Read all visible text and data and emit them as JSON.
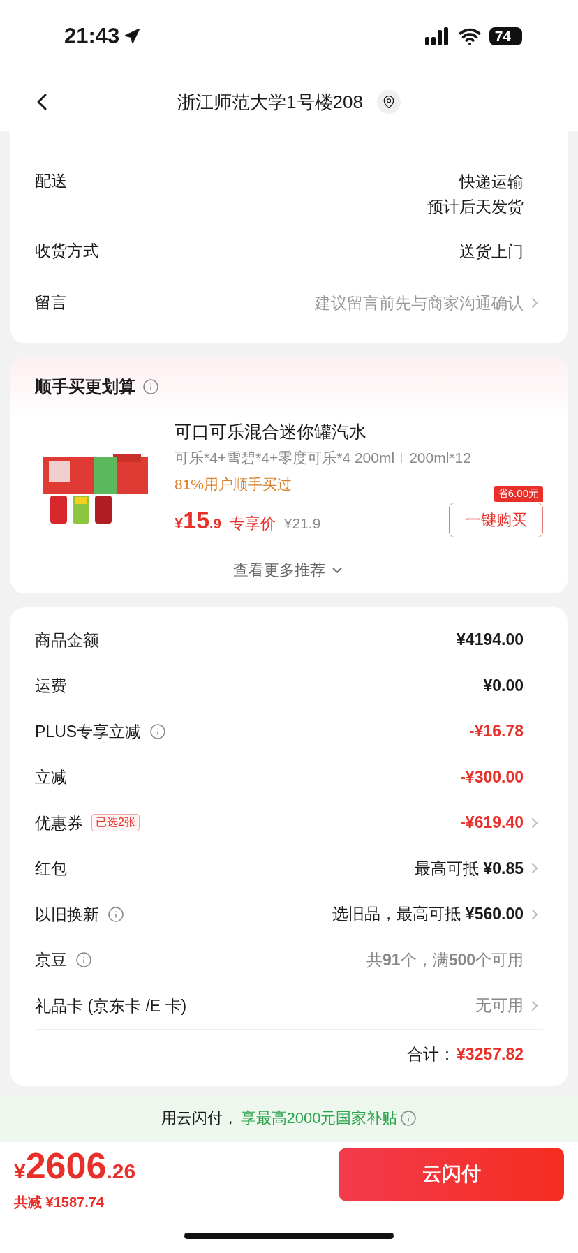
{
  "status_bar": {
    "time": "21:43",
    "battery": "74"
  },
  "header": {
    "title": "浙江师范大学1号楼208"
  },
  "order_info": [
    {
      "label": "配送",
      "values": [
        "快递运输",
        "预计后天发货"
      ],
      "muted": false,
      "chevron": false
    },
    {
      "label": "收货方式",
      "values": [
        "送货上门"
      ],
      "muted": false,
      "chevron": false
    },
    {
      "label": "留言",
      "values": [
        "建议留言前先与商家沟通确认"
      ],
      "muted": true,
      "chevron": true
    }
  ],
  "recommend": {
    "title": "顺手买更划算",
    "product": {
      "name": "可口可乐混合迷你罐汽水",
      "spec": "可乐*4+雪碧*4+零度可乐*4 200ml",
      "spec_size": "200ml*12",
      "social_proof": "81%用户顺手买过",
      "currency": "¥",
      "price_int": "15",
      "price_dec": ".9",
      "price_label": "专享价",
      "original_price": "¥21.9",
      "save_badge": "省6.00元",
      "buy_button": "一键购买"
    },
    "more": "查看更多推荐"
  },
  "summary": [
    {
      "label": "商品金额",
      "info": false,
      "value": "¥4194.00",
      "kind": "amount",
      "chevron": false
    },
    {
      "label": "运费",
      "info": false,
      "value": "¥0.00",
      "kind": "amount",
      "chevron": false
    },
    {
      "label": "PLUS专享立减",
      "info": true,
      "value": "-¥16.78",
      "kind": "discount",
      "chevron": false
    },
    {
      "label": "立减",
      "info": false,
      "value": "-¥300.00",
      "kind": "discount",
      "chevron": false
    },
    {
      "label": "优惠券",
      "info": false,
      "tag": "已选2张",
      "value": "-¥619.40",
      "kind": "discount",
      "chevron": true
    },
    {
      "label": "红包",
      "info": false,
      "value": "最高可抵 **¥0.85**",
      "kind": "text",
      "chevron": true
    },
    {
      "label": "以旧换新",
      "info": true,
      "value": "选旧品，最高可抵 **¥560.00**",
      "kind": "text",
      "chevron": true
    },
    {
      "label": "京豆",
      "info": true,
      "value": "共**91**个，满**500**个可用",
      "kind": "muted",
      "chevron": false
    },
    {
      "label": "礼品卡 (京东卡 /E 卡)",
      "info": false,
      "value": "无可用",
      "kind": "muted",
      "chevron": true
    }
  ],
  "total": {
    "label": "合计：",
    "value": "¥3257.82"
  },
  "banner": {
    "prefix": "用云闪付，",
    "highlight": "享最高2000元国家补贴",
    "info": true
  },
  "footer": {
    "currency": "¥",
    "price_int": "2606",
    "price_dec": ".26",
    "saved": "共减 ¥1587.74",
    "pay_button": "云闪付"
  }
}
